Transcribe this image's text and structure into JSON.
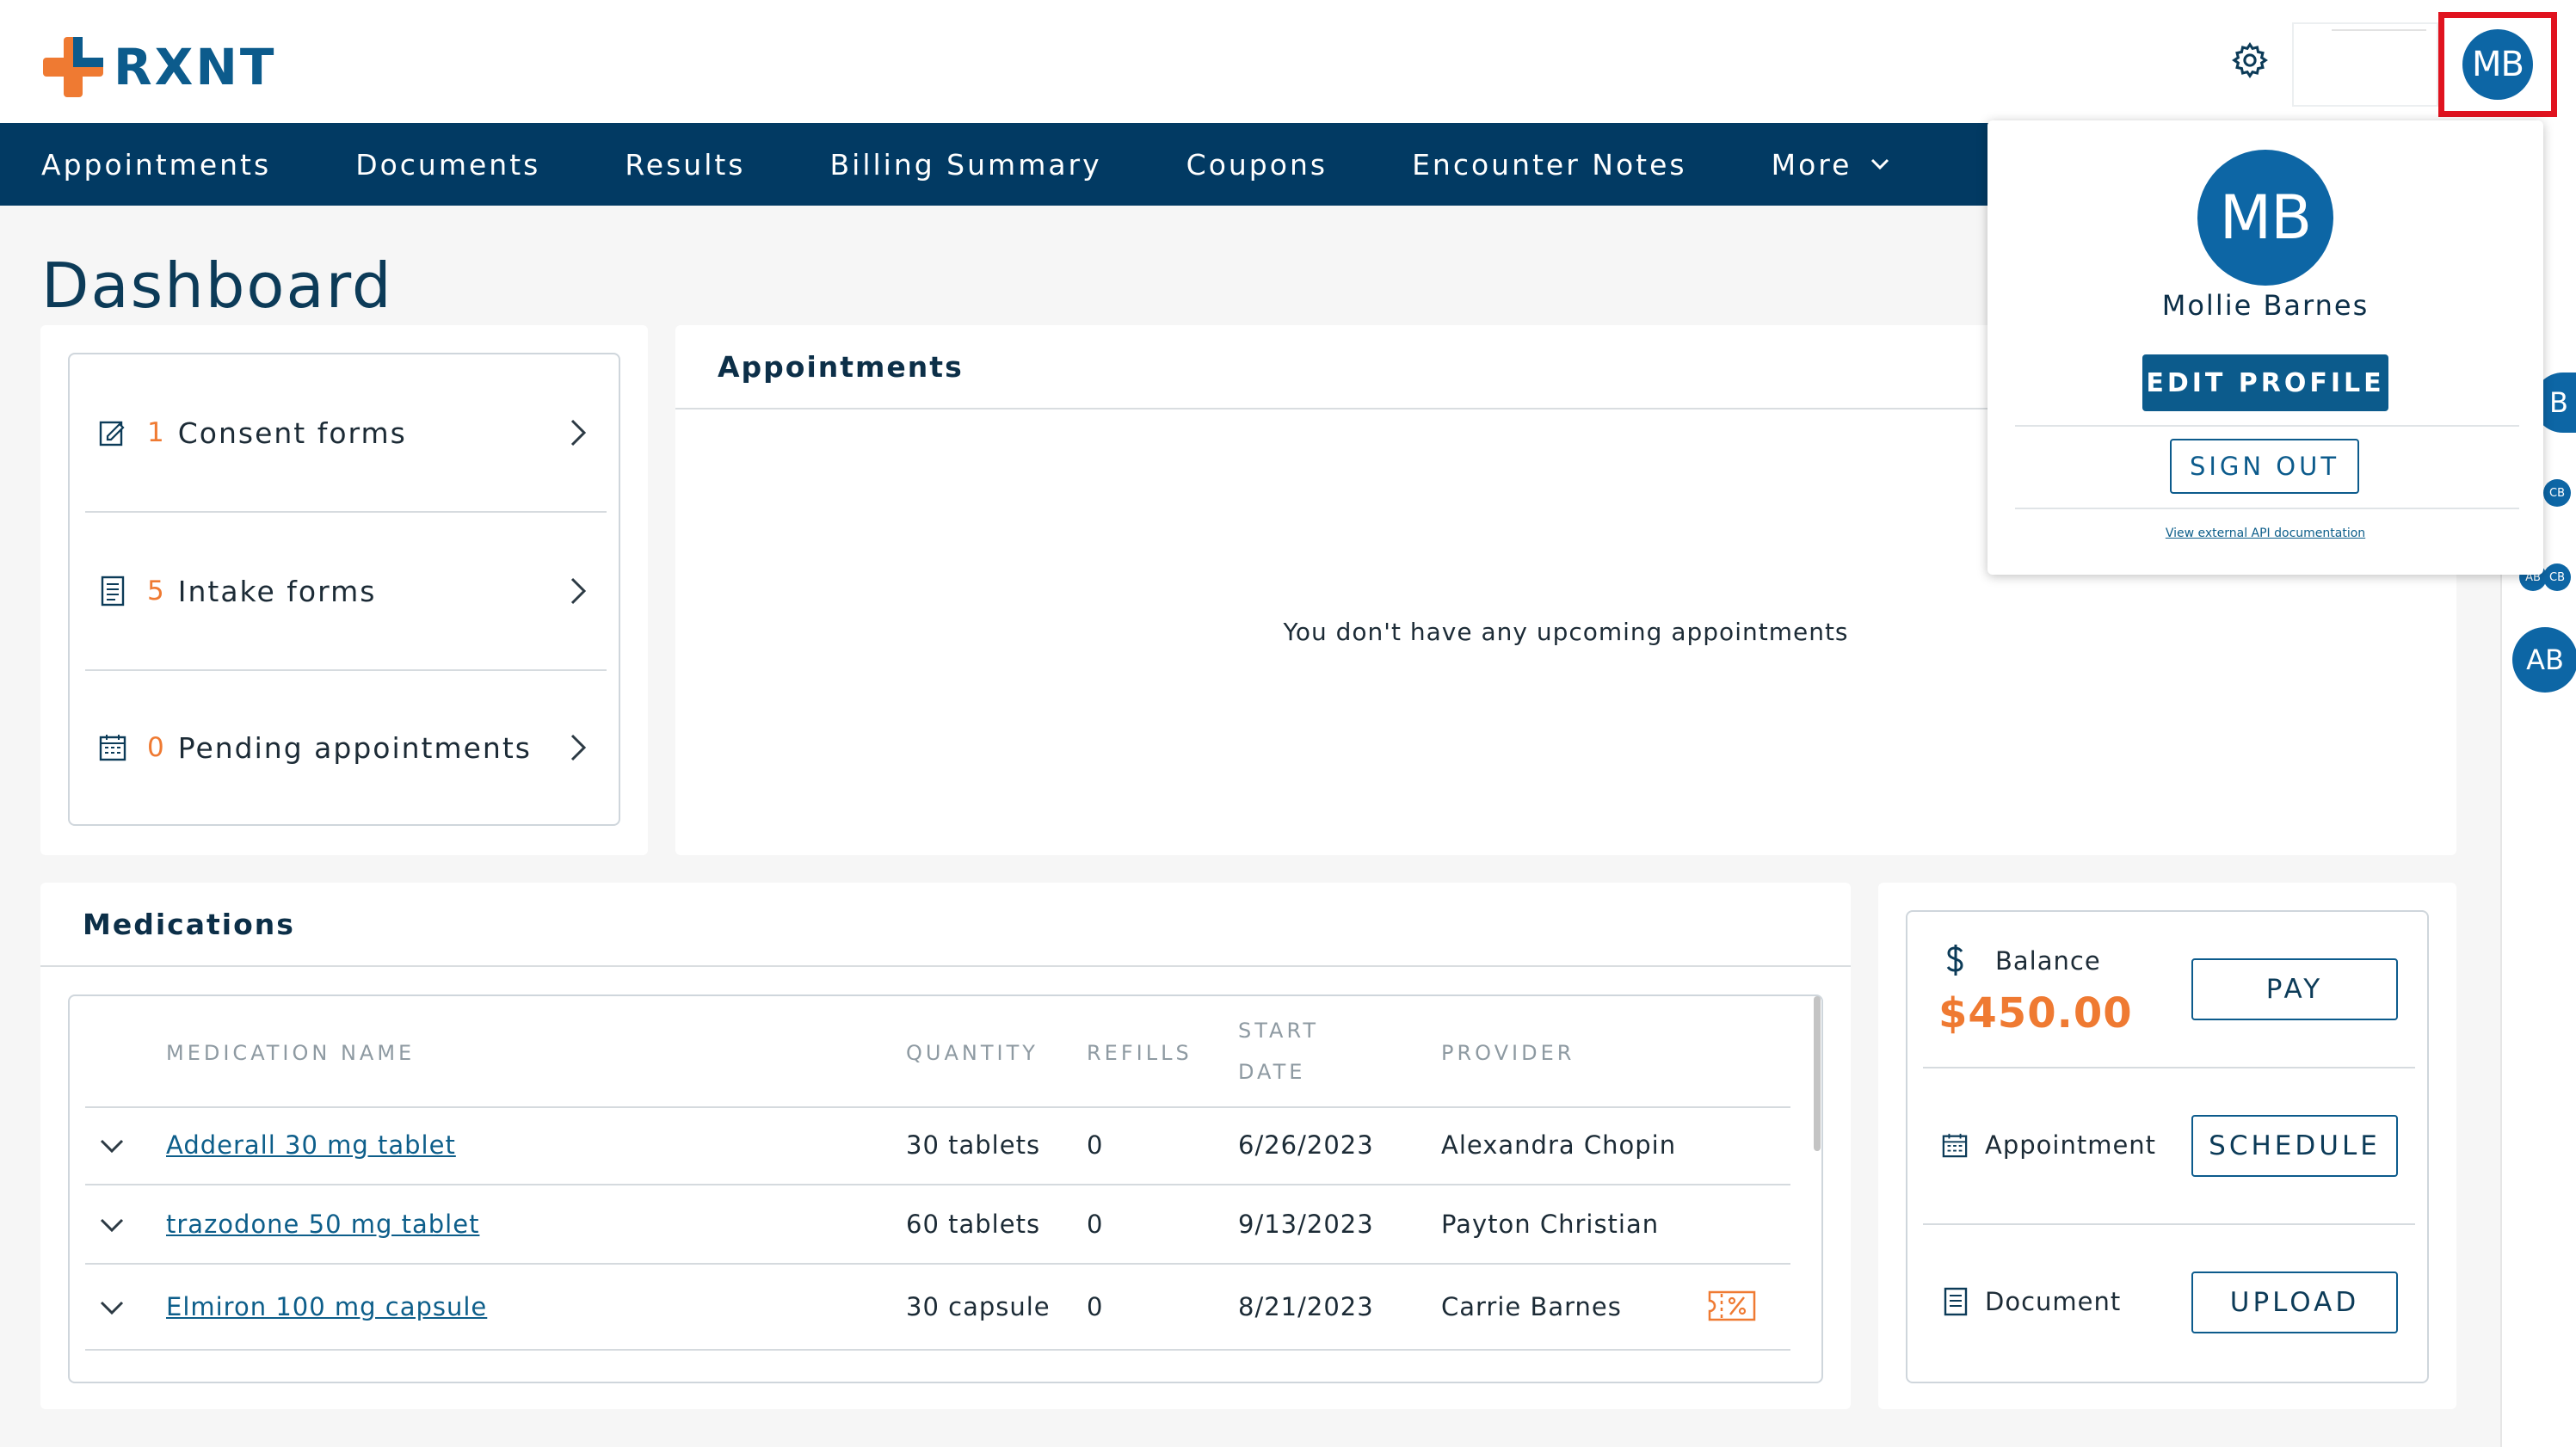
{
  "brand": {
    "name": "RXNT"
  },
  "header": {
    "avatar_initials": "MB"
  },
  "nav": {
    "items": [
      "Appointments",
      "Documents",
      "Results",
      "Billing Summary",
      "Coupons",
      "Encounter Notes"
    ],
    "more_label": "More"
  },
  "page": {
    "title": "Dashboard"
  },
  "quick_links": [
    {
      "count": "1",
      "label": "Consent forms",
      "icon": "consent-form-icon"
    },
    {
      "count": "5",
      "label": "Intake forms",
      "icon": "intake-form-icon"
    },
    {
      "count": "0",
      "label": "Pending appointments",
      "icon": "calendar-icon"
    }
  ],
  "appointments": {
    "title": "Appointments",
    "empty_message": "You don't have any upcoming appointments"
  },
  "medications": {
    "title": "Medications",
    "columns": {
      "name": "MEDICATION NAME",
      "quantity": "QUANTITY",
      "refills": "REFILLS",
      "start_line1": "START",
      "start_line2": "DATE",
      "provider": "PROVIDER"
    },
    "rows": [
      {
        "name": "Adderall 30 mg tablet",
        "quantity": "30 tablets",
        "refills": "0",
        "start_date": "6/26/2023",
        "provider": "Alexandra Chopin"
      },
      {
        "name": "trazodone 50 mg tablet",
        "quantity": "60 tablets",
        "refills": "0",
        "start_date": "9/13/2023",
        "provider": "Payton Christian"
      },
      {
        "name": "Elmiron 100 mg capsule",
        "quantity": "30 capsule",
        "refills": "0",
        "start_date": "8/21/2023",
        "provider": "Carrie Barnes",
        "coupon_icon": "coupon-icon"
      }
    ]
  },
  "actions": {
    "balance_label": "Balance",
    "balance_amount": "$450.00",
    "pay_label": "PAY",
    "appointment_label": "Appointment",
    "schedule_label": "SCHEDULE",
    "document_label": "Document",
    "upload_label": "UPLOAD"
  },
  "profile_menu": {
    "initials": "MB",
    "name": "Mollie Barnes",
    "edit_label": "EDIT PROFILE",
    "signout_label": "SIGN OUT",
    "api_link": "View external API documentation"
  },
  "side_panel": {
    "avatar_b": "B",
    "avatar_cb": "CB",
    "avatar_ab_small": "AB",
    "avatar_cb_small": "CB",
    "avatar_ab": "AB"
  },
  "colors": {
    "brand_blue": "#0c5b8c",
    "nav_bg": "#023a63",
    "accent_orange": "#ef7a32",
    "highlight_red": "#e0131f"
  }
}
